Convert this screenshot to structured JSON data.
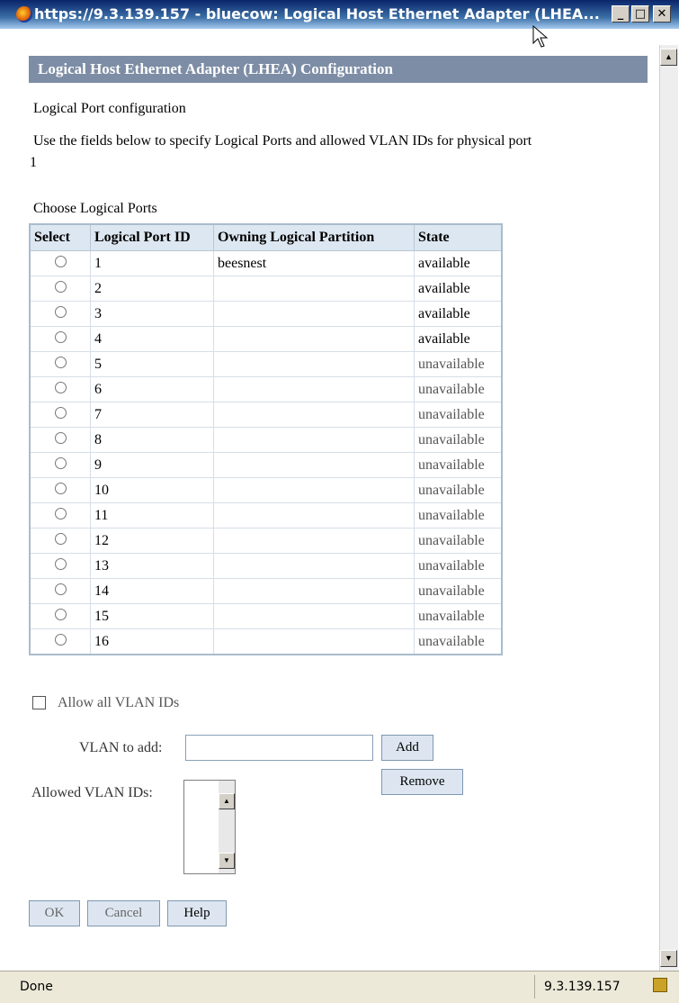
{
  "window": {
    "title": "https://9.3.139.157 - bluecow: Logical Host Ethernet Adapter (LHEA...",
    "minimize_label": "_",
    "maximize_label": "□",
    "close_label": "✕"
  },
  "header": {
    "title": "Logical Host Ethernet Adapter (LHEA) Configuration"
  },
  "section": {
    "subtitle": "Logical Port configuration",
    "instructions_line1": "Use the fields below to specify Logical Ports and allowed VLAN IDs for physical port",
    "instructions_line2": "1"
  },
  "ports": {
    "caption": "Choose Logical Ports",
    "columns": [
      "Select",
      "Logical Port ID",
      "Owning Logical Partition",
      "State"
    ],
    "rows": [
      {
        "id": "1",
        "partition": "beesnest",
        "state": "available"
      },
      {
        "id": "2",
        "partition": "",
        "state": "available"
      },
      {
        "id": "3",
        "partition": "",
        "state": "available"
      },
      {
        "id": "4",
        "partition": "",
        "state": "available"
      },
      {
        "id": "5",
        "partition": "",
        "state": "unavailable"
      },
      {
        "id": "6",
        "partition": "",
        "state": "unavailable"
      },
      {
        "id": "7",
        "partition": "",
        "state": "unavailable"
      },
      {
        "id": "8",
        "partition": "",
        "state": "unavailable"
      },
      {
        "id": "9",
        "partition": "",
        "state": "unavailable"
      },
      {
        "id": "10",
        "partition": "",
        "state": "unavailable"
      },
      {
        "id": "11",
        "partition": "",
        "state": "unavailable"
      },
      {
        "id": "12",
        "partition": "",
        "state": "unavailable"
      },
      {
        "id": "13",
        "partition": "",
        "state": "unavailable"
      },
      {
        "id": "14",
        "partition": "",
        "state": "unavailable"
      },
      {
        "id": "15",
        "partition": "",
        "state": "unavailable"
      },
      {
        "id": "16",
        "partition": "",
        "state": "unavailable"
      }
    ]
  },
  "vlan": {
    "allow_all_label": "Allow all VLAN IDs",
    "allow_all_checked": false,
    "add_label": "VLAN to add:",
    "add_value": "",
    "add_button": "Add",
    "remove_button": "Remove",
    "allowed_label": "Allowed VLAN IDs:",
    "allowed_values": []
  },
  "actions": {
    "ok": "OK",
    "cancel": "Cancel",
    "help": "Help"
  },
  "statusbar": {
    "status": "Done",
    "host": "9.3.139.157"
  }
}
